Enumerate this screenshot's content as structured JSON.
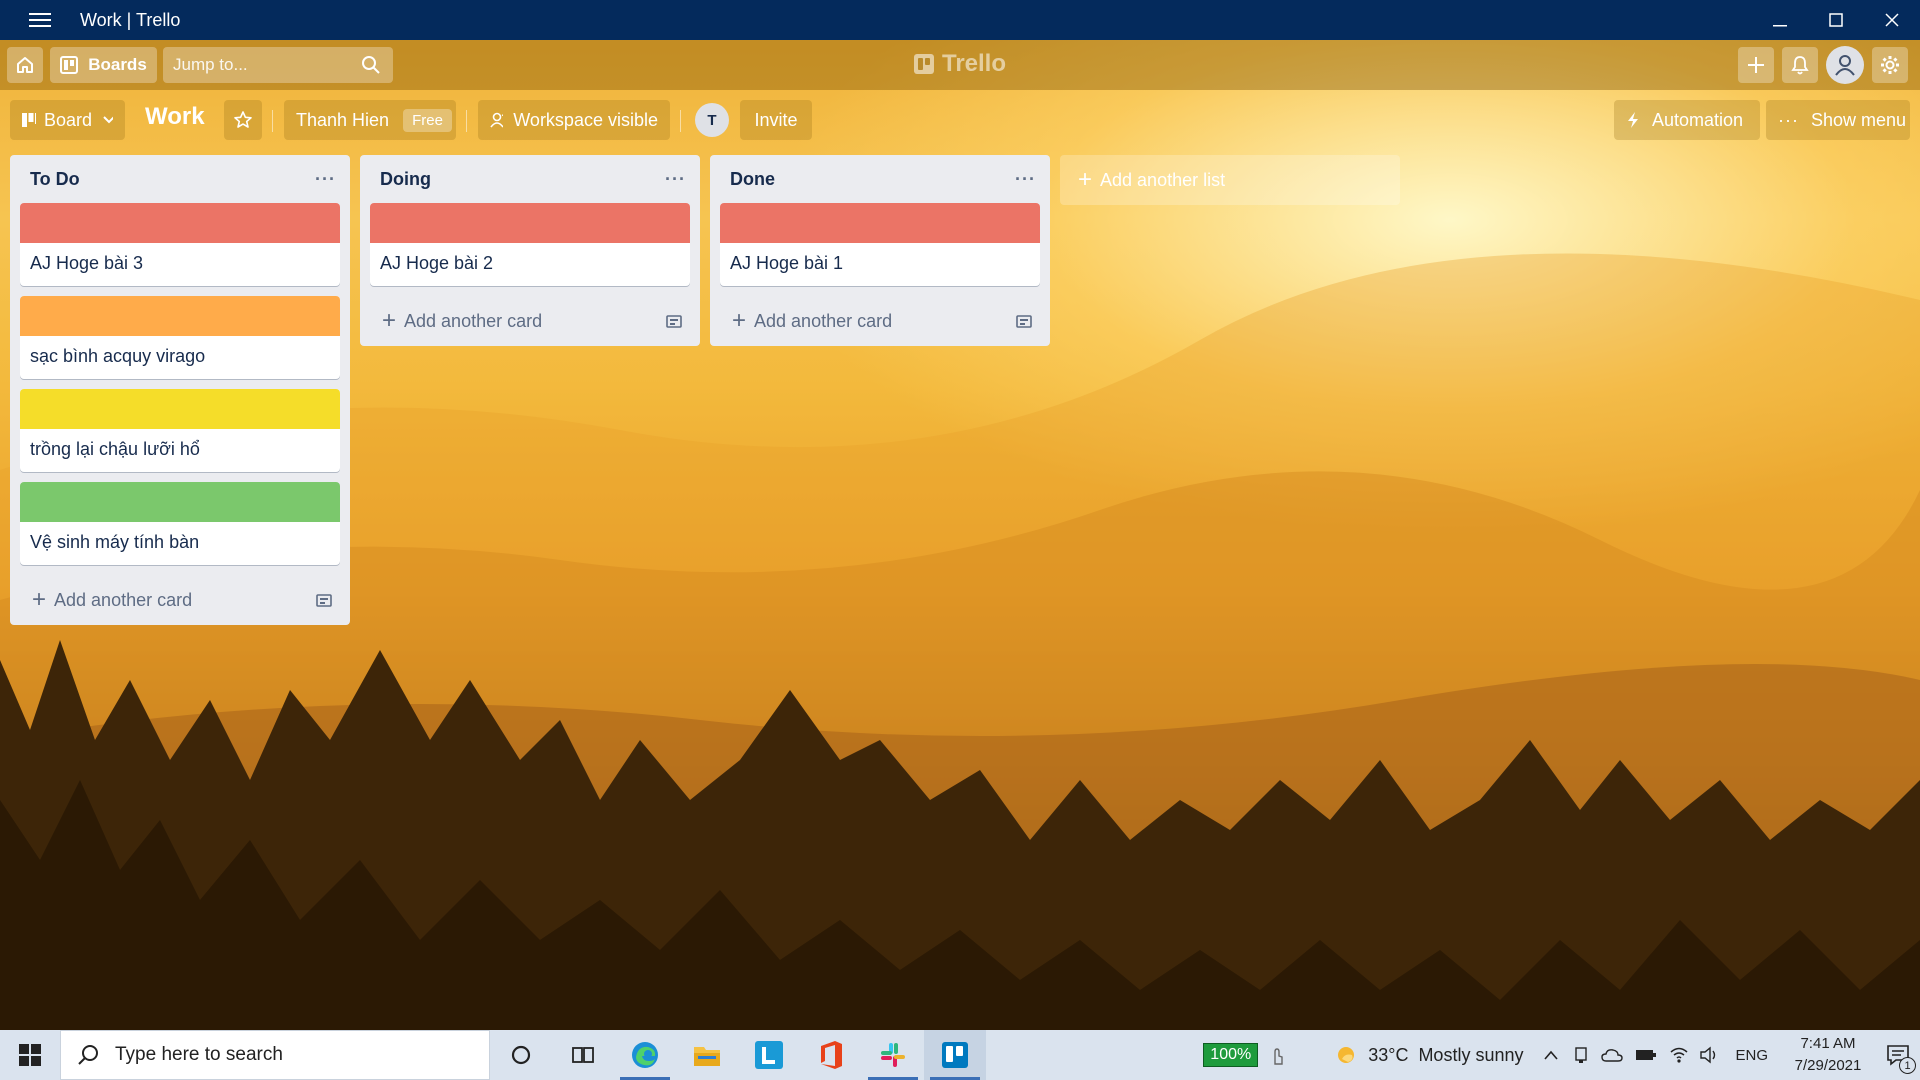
{
  "window": {
    "title": "Work | Trello"
  },
  "header": {
    "boards_label": "Boards",
    "search_placeholder": "Jump to...",
    "logo_text": "Trello"
  },
  "board": {
    "view_label": "Board",
    "title": "Work",
    "workspace_name": "Thanh Hien",
    "plan_badge": "Free",
    "visibility_label": "Workspace visible",
    "member_initial": "T",
    "invite_label": "Invite",
    "automation_label": "Automation",
    "show_menu_label": "Show menu"
  },
  "lists": [
    {
      "name": "To Do",
      "cards": [
        {
          "text": "AJ Hoge bài 3",
          "label_color": "#eb7466"
        },
        {
          "text": "sạc bình acquy virago",
          "label_color": "#ffab4a"
        },
        {
          "text": "trồng lại chậu lưỡi hổ",
          "label_color": "#f5dd29"
        },
        {
          "text": "Vệ sinh máy tính bàn",
          "label_color": "#7bc86c"
        }
      ],
      "add_card_label": "Add another card"
    },
    {
      "name": "Doing",
      "cards": [
        {
          "text": "AJ Hoge bài 2",
          "label_color": "#eb7466"
        }
      ],
      "add_card_label": "Add another card"
    },
    {
      "name": "Done",
      "cards": [
        {
          "text": "AJ Hoge bài 1",
          "label_color": "#eb7466"
        }
      ],
      "add_card_label": "Add another card"
    }
  ],
  "add_list_label": "Add another list",
  "taskbar": {
    "search_placeholder": "Type here to search",
    "battery": "100%",
    "weather": "33°C",
    "weather_desc": "Mostly sunny",
    "language": "ENG",
    "time": "7:41 AM",
    "date": "7/29/2021",
    "notification_count": "1"
  }
}
